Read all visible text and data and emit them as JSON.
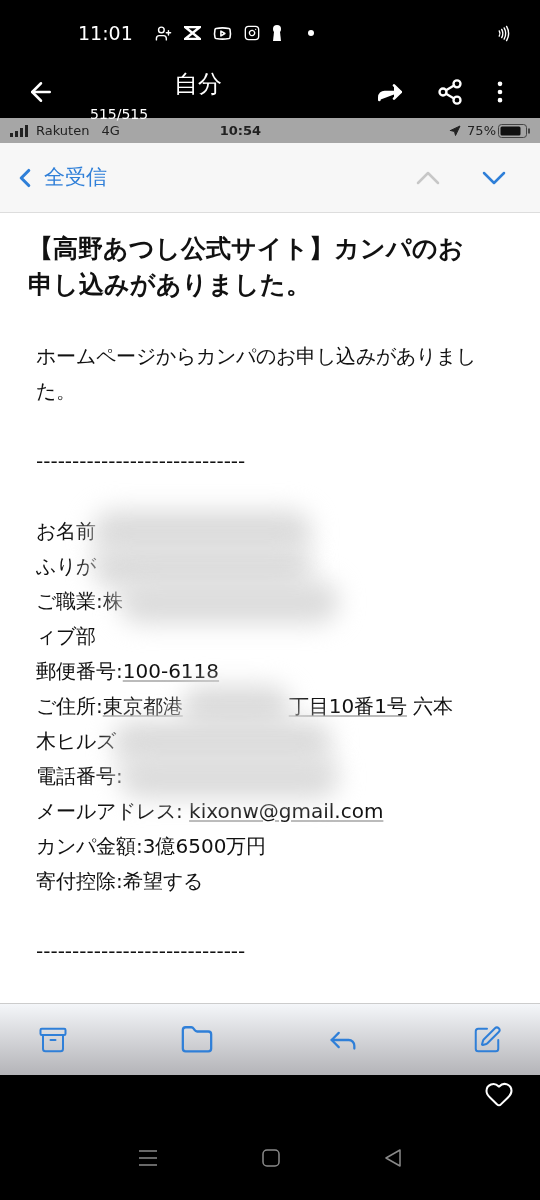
{
  "phone_status": {
    "time": "11:01"
  },
  "viewer": {
    "title": "自分",
    "counter": "515/515"
  },
  "ios_status": {
    "carrier": "Rakuten",
    "network": "4G",
    "time": "10:54",
    "battery": "75%"
  },
  "mail_nav": {
    "back_label": "全受信",
    "prev_disabled": true,
    "next_disabled": false
  },
  "email": {
    "subject": "【高野あつし公式サイト】カンパのお申し込みがありました。",
    "intro": "ホームページからカンパのお申し込みがありました。",
    "separator_top": "-----------------------------",
    "lines": [
      [
        {
          "kind": "text",
          "text": "お名前"
        },
        {
          "kind": "redacted"
        }
      ],
      [
        {
          "kind": "text",
          "text": "ふりが"
        },
        {
          "kind": "redacted"
        }
      ],
      [
        {
          "kind": "text",
          "text": "ご職業:株"
        },
        {
          "kind": "redacted"
        }
      ],
      [
        {
          "kind": "text",
          "text": "ィブ部"
        }
      ],
      [
        {
          "kind": "text",
          "text": "郵便番号:"
        },
        {
          "kind": "link",
          "text": "100-6118"
        }
      ],
      [
        {
          "kind": "text",
          "text": "ご住所:"
        },
        {
          "kind": "link",
          "text": "東京都港"
        },
        {
          "kind": "redacted"
        },
        {
          "kind": "link",
          "text": "丁目10番1号"
        },
        {
          "kind": "text",
          "text": " 六本"
        }
      ],
      [
        {
          "kind": "text",
          "text": "木ヒルズ"
        },
        {
          "kind": "redacted"
        }
      ],
      [
        {
          "kind": "text",
          "text": "電話番号:"
        },
        {
          "kind": "redacted"
        }
      ],
      [
        {
          "kind": "text",
          "text": "メールアドレス: "
        },
        {
          "kind": "link",
          "text": "kixonw@gmail.com"
        }
      ],
      [
        {
          "kind": "text",
          "text": "カンパ金額:3億6500万円"
        }
      ],
      [
        {
          "kind": "text",
          "text": "寄付控除:希望する"
        }
      ]
    ],
    "separator_bottom": "-----------------------------"
  }
}
